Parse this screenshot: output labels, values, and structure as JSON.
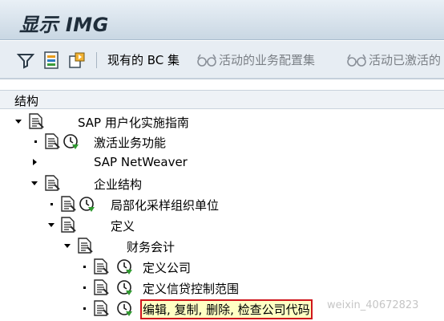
{
  "window": {
    "title": "显示 IMG"
  },
  "toolbar": {
    "icons": [
      "filter-icon",
      "customizing-project-icon",
      "save-variant-icon"
    ],
    "bc_sets_label": "现有的 BC 集",
    "activated_bc_sets_label": "活动的业务配置集",
    "activate_log_label": "活动已激活的"
  },
  "tree": {
    "header": "结构",
    "nodes": [
      {
        "label": "SAP 用户化实施指南",
        "expanded": true,
        "level": 0
      },
      {
        "label": "激活业务功能",
        "level": 1
      },
      {
        "label": "SAP NetWeaver",
        "expanded": false,
        "level": 1
      },
      {
        "label": "企业结构",
        "expanded": true,
        "level": 1
      },
      {
        "label": "局部化采样组织单位",
        "level": 2
      },
      {
        "label": "定义",
        "expanded": true,
        "level": 2
      },
      {
        "label": "财务会计",
        "expanded": true,
        "level": 3
      },
      {
        "label": "定义公司",
        "level": 4
      },
      {
        "label": "定义信贷控制范围",
        "level": 4
      },
      {
        "label": "编辑, 复制, 删除, 检查公司代码",
        "level": 4,
        "selected": true
      }
    ]
  },
  "watermark": "weixin_40672823"
}
